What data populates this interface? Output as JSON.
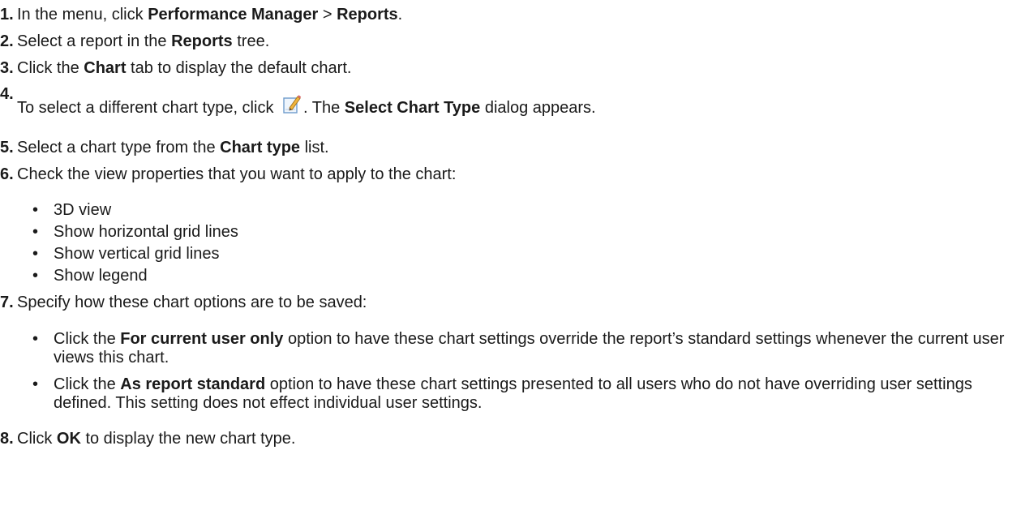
{
  "steps": [
    {
      "num": "1.",
      "parts": [
        "In the menu, click ",
        "Performance Manager",
        " > ",
        "Reports",
        "."
      ]
    },
    {
      "num": "2.",
      "parts": [
        "Select a report in the ",
        "Reports",
        " tree."
      ]
    },
    {
      "num": "3.",
      "parts": [
        "Click the ",
        "Chart",
        " tab to display the default chart."
      ]
    },
    {
      "num": "4.",
      "parts": [
        "To select a different chart type, click ",
        ". The ",
        "Select Chart Type",
        " dialog appears."
      ],
      "icon": "edit-pencil-icon"
    },
    {
      "num": "5.",
      "parts": [
        "Select a chart type from the ",
        "Chart type",
        " list."
      ]
    },
    {
      "num": "6.",
      "parts": [
        "Check the view properties that you want to apply to the chart:"
      ],
      "bullets": [
        "3D view",
        "Show horizontal grid lines",
        "Show vertical grid lines",
        "Show legend"
      ]
    },
    {
      "num": "7.",
      "parts": [
        "Specify how these chart options are to be saved:"
      ],
      "bullets": [
        {
          "parts": [
            "Click the ",
            "For current user only",
            " option to have these chart settings override the report’s standard settings whenever the current user views this chart."
          ]
        },
        {
          "parts": [
            "Click the ",
            "As report standard",
            " option to have these chart settings presented to all users who do not have overriding user settings defined. This setting does not effect individual user settings."
          ]
        }
      ]
    },
    {
      "num": "8.",
      "parts": [
        "Click ",
        "OK",
        " to display the new chart type."
      ]
    }
  ],
  "bullet_char": "•"
}
